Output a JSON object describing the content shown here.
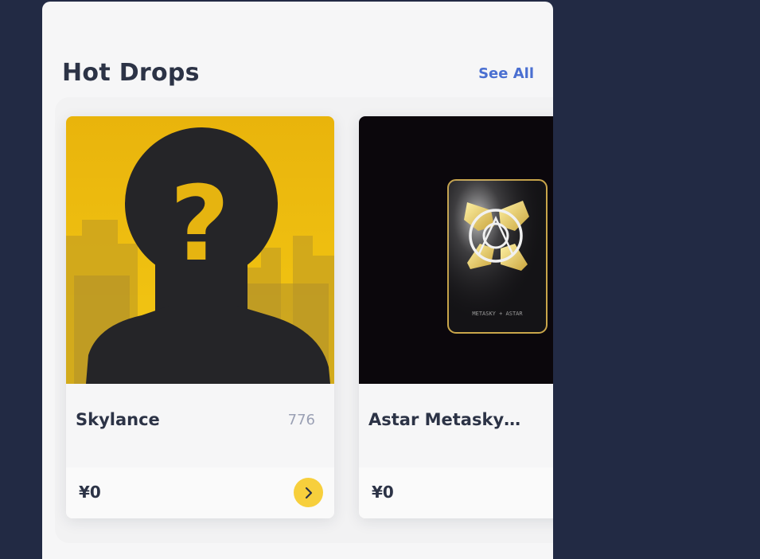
{
  "section": {
    "title": "Hot Drops",
    "see_all_label": "See All"
  },
  "cards": [
    {
      "name": "Skylance",
      "count": "776",
      "price": "¥0",
      "image_icon": "mystery-silhouette-image"
    },
    {
      "name": "Astar Metasky…",
      "price": "¥0",
      "image_icon": "metasky-astar-card-image",
      "image_caption": "METASKY + ASTAR"
    }
  ],
  "colors": {
    "page_background": "#222a44",
    "panel_background": "#f6f6f7",
    "accent_link": "#4a6fd1",
    "arrow_button": "#f7cf3c",
    "card1_background": "#f2c40c"
  }
}
